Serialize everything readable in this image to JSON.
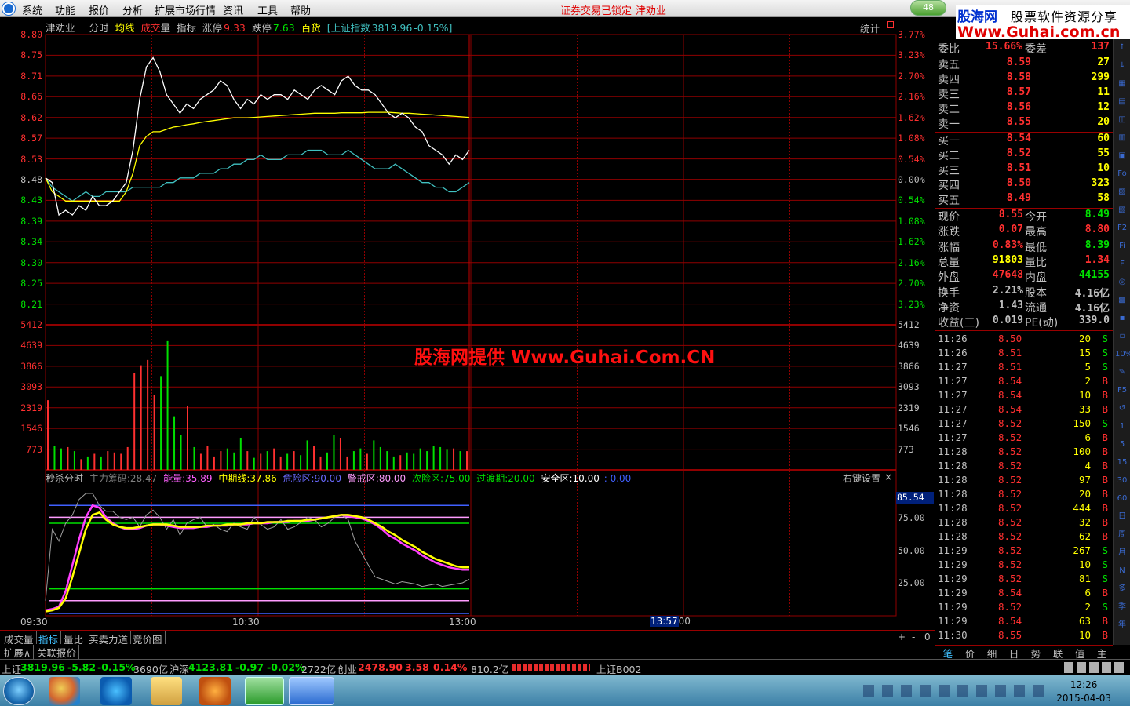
{
  "menu": {
    "items": [
      "系统",
      "功能",
      "报价",
      "分析",
      "扩展市场行情",
      "资讯",
      "工具",
      "帮助"
    ],
    "lock_status": "证券交易已锁定",
    "stock_name": "津劝业",
    "badge": "48"
  },
  "logo": {
    "line1": "股海网",
    "line1b": "股票软件资源分享",
    "line2": "Www.Guhai.com.cn"
  },
  "watermark": "股海网提供 Www.Guhai.Com.CN",
  "infobar": {
    "name": "津劝业",
    "mode": "分时",
    "avg": "均线",
    "vol1": "成交",
    "vol2": "量",
    "ind": "指标",
    "zt_label": "涨停",
    "zt": "9.33",
    "dt_label": "跌停",
    "dt": "7.63",
    "sector": "百货",
    "index": "[上证指数",
    "index_val": "3819.96",
    "index_chg": "-0.15%]",
    "stat": "统计"
  },
  "price_axis": {
    "left": [
      "8.80",
      "8.75",
      "8.71",
      "8.66",
      "8.62",
      "8.57",
      "8.53",
      "8.48",
      "8.43",
      "8.39",
      "8.34",
      "8.30",
      "8.25",
      "8.21"
    ],
    "right": [
      "3.77%",
      "3.23%",
      "2.70%",
      "2.16%",
      "1.62%",
      "1.08%",
      "0.54%",
      "0.00%",
      "0.54%",
      "1.08%",
      "1.62%",
      "2.16%",
      "2.70%",
      "3.23%"
    ],
    "ref_index": 7
  },
  "vol_axis": [
    "5412",
    "4639",
    "3866",
    "3093",
    "2319",
    "1546",
    "773"
  ],
  "ind_bar": {
    "name": "秒杀分时",
    "zl_label": "主力筹码:",
    "zl": "28.47",
    "nl_label": "能量:",
    "nl": "35.89",
    "zq_label": "中期线:",
    "zq": "37.86",
    "wx_label": "危险区:",
    "wx": "90.00",
    "jj_label": "警戒区:",
    "jj": "80.00",
    "cw_label": "次险区:",
    "cw": "75.00",
    "gd_label": "过渡期:",
    "gd": "20.00",
    "aq_label": "安全区:",
    "aq": "10.00",
    "tail": ": 0.00",
    "rclick": "右键设置",
    "close": "×"
  },
  "ind_axis": {
    "hl": "85.54",
    "ticks": [
      "75.00",
      "50.00",
      "25.00"
    ]
  },
  "time_axis": [
    "09:30",
    "10:30",
    "13:00"
  ],
  "cursor_time": "13:57",
  "cursor_tail": "00",
  "chart_controls": [
    "+",
    "-",
    "0"
  ],
  "bottom_tabs": [
    "成交量",
    "指标",
    "量比",
    "买卖力道",
    "竞价图"
  ],
  "ext_tabs": [
    "扩展∧",
    "关联报价"
  ],
  "orderbook": {
    "wb_label": "委比",
    "wb": "15.66%",
    "wc_label": "委差",
    "wc": "137",
    "asks": [
      {
        "label": "卖五",
        "price": "8.59",
        "vol": "27"
      },
      {
        "label": "卖四",
        "price": "8.58",
        "vol": "299"
      },
      {
        "label": "卖三",
        "price": "8.57",
        "vol": "11"
      },
      {
        "label": "卖二",
        "price": "8.56",
        "vol": "12"
      },
      {
        "label": "卖一",
        "price": "8.55",
        "vol": "20"
      }
    ],
    "bids": [
      {
        "label": "买一",
        "price": "8.54",
        "vol": "60"
      },
      {
        "label": "买二",
        "price": "8.52",
        "vol": "55"
      },
      {
        "label": "买三",
        "price": "8.51",
        "vol": "10"
      },
      {
        "label": "买四",
        "price": "8.50",
        "vol": "323"
      },
      {
        "label": "买五",
        "price": "8.49",
        "vol": "58"
      }
    ]
  },
  "stats": [
    {
      "l1": "现价",
      "v1": "8.55",
      "c1": "#ff3030",
      "l2": "今开",
      "v2": "8.49",
      "c2": "#00e000"
    },
    {
      "l1": "涨跌",
      "v1": "0.07",
      "c1": "#ff3030",
      "l2": "最高",
      "v2": "8.80",
      "c2": "#ff3030"
    },
    {
      "l1": "涨幅",
      "v1": "0.83%",
      "c1": "#ff3030",
      "l2": "最低",
      "v2": "8.39",
      "c2": "#00e000"
    },
    {
      "l1": "总量",
      "v1": "91803",
      "c1": "#ffff00",
      "l2": "量比",
      "v2": "1.34",
      "c2": "#ff3030"
    },
    {
      "l1": "外盘",
      "v1": "47648",
      "c1": "#ff3030",
      "l2": "内盘",
      "v2": "44155",
      "c2": "#00e000"
    },
    {
      "l1": "换手",
      "v1": "2.21%",
      "c1": "#c0c0c0",
      "l2": "股本",
      "v2": "4.16亿",
      "c2": "#c0c0c0"
    },
    {
      "l1": "净资",
      "v1": "1.43",
      "c1": "#c0c0c0",
      "l2": "流通",
      "v2": "4.16亿",
      "c2": "#c0c0c0"
    },
    {
      "l1": "收益(三)",
      "v1": "0.019",
      "c1": "#c0c0c0",
      "l2": "PE(动)",
      "v2": "339.0",
      "c2": "#c0c0c0"
    }
  ],
  "ticks": [
    {
      "t": "11:26",
      "p": "8.50",
      "v": "20",
      "s": "S"
    },
    {
      "t": "11:26",
      "p": "8.51",
      "v": "15",
      "s": "S"
    },
    {
      "t": "11:27",
      "p": "8.51",
      "v": "5",
      "s": "S"
    },
    {
      "t": "11:27",
      "p": "8.54",
      "v": "2",
      "s": "B"
    },
    {
      "t": "11:27",
      "p": "8.54",
      "v": "10",
      "s": "B"
    },
    {
      "t": "11:27",
      "p": "8.54",
      "v": "33",
      "s": "B"
    },
    {
      "t": "11:27",
      "p": "8.52",
      "v": "150",
      "s": "S"
    },
    {
      "t": "11:27",
      "p": "8.52",
      "v": "6",
      "s": "B"
    },
    {
      "t": "11:28",
      "p": "8.52",
      "v": "100",
      "s": "B"
    },
    {
      "t": "11:28",
      "p": "8.52",
      "v": "4",
      "s": "B"
    },
    {
      "t": "11:28",
      "p": "8.52",
      "v": "97",
      "s": "B"
    },
    {
      "t": "11:28",
      "p": "8.52",
      "v": "20",
      "s": "B"
    },
    {
      "t": "11:28",
      "p": "8.52",
      "v": "444",
      "s": "B"
    },
    {
      "t": "11:28",
      "p": "8.52",
      "v": "32",
      "s": "B"
    },
    {
      "t": "11:28",
      "p": "8.52",
      "v": "62",
      "s": "B"
    },
    {
      "t": "11:29",
      "p": "8.52",
      "v": "267",
      "s": "S"
    },
    {
      "t": "11:29",
      "p": "8.52",
      "v": "10",
      "s": "S"
    },
    {
      "t": "11:29",
      "p": "8.52",
      "v": "81",
      "s": "S"
    },
    {
      "t": "11:29",
      "p": "8.54",
      "v": "6",
      "s": "B"
    },
    {
      "t": "11:29",
      "p": "8.52",
      "v": "2",
      "s": "S"
    },
    {
      "t": "11:29",
      "p": "8.54",
      "v": "63",
      "s": "B"
    },
    {
      "t": "11:30",
      "p": "8.55",
      "v": "10",
      "s": "B"
    }
  ],
  "rp_tabs": [
    "笔",
    "价",
    "细",
    "日",
    "势",
    "联",
    "值",
    "主"
  ],
  "sidebar": [
    "↑",
    "↓",
    "▦",
    "▤",
    "◫",
    "▥",
    "▣",
    "Fo",
    "▨",
    "▧",
    "F2",
    "Fi",
    "F",
    "◎",
    "▩",
    "▪",
    "▫",
    "10%",
    "✎",
    "F5",
    "↺",
    "1",
    "5",
    "15",
    "30",
    "60",
    "日",
    "周",
    "月",
    "N",
    "多",
    "季",
    "年"
  ],
  "ticker": {
    "sh_label": "上证",
    "sh": "3819.96",
    "sh_chg": "-5.82",
    "sh_pct": "-0.15%",
    "sh_amt": "3690亿",
    "sz_label": "沪深",
    "sz": "4123.81",
    "sz_chg": "-0.97",
    "sz_pct": "-0.02%",
    "sz_amt": "2722亿",
    "cy_label": "创业",
    "cy": "2478.90",
    "cy_chg": "3.58",
    "cy_pct": "0.14%",
    "cy_amt": "810.2亿",
    "code": "上证B002"
  },
  "clock": {
    "time": "12:26",
    "date": "2015-04-03"
  },
  "colors": {
    "up": "#ff3030",
    "down": "#00e000",
    "grid": "#900000",
    "axis_up": "#ff3030",
    "yellow": "#ffff00",
    "cyan": "#40c0c0"
  },
  "chart_data": {
    "type": "line",
    "price": [
      8.49,
      8.48,
      8.41,
      8.42,
      8.41,
      8.43,
      8.42,
      8.45,
      8.43,
      8.43,
      8.44,
      8.46,
      8.48,
      8.55,
      8.66,
      8.73,
      8.75,
      8.72,
      8.67,
      8.65,
      8.63,
      8.65,
      8.64,
      8.66,
      8.67,
      8.68,
      8.7,
      8.69,
      8.66,
      8.64,
      8.66,
      8.65,
      8.67,
      8.66,
      8.67,
      8.67,
      8.66,
      8.68,
      8.67,
      8.66,
      8.68,
      8.69,
      8.68,
      8.67,
      8.7,
      8.71,
      8.69,
      8.68,
      8.68,
      8.67,
      8.65,
      8.63,
      8.62,
      8.63,
      8.62,
      8.6,
      8.59,
      8.56,
      8.55,
      8.54,
      8.52,
      8.54,
      8.53,
      8.55
    ],
    "avg": [
      8.49,
      8.46,
      8.45,
      8.44,
      8.44,
      8.44,
      8.44,
      8.44,
      8.44,
      8.44,
      8.44,
      8.44,
      8.46,
      8.5,
      8.56,
      8.58,
      8.59,
      8.59,
      8.595,
      8.6,
      8.602,
      8.605,
      8.607,
      8.61,
      8.612,
      8.614,
      8.616,
      8.618,
      8.62,
      8.62,
      8.62,
      8.621,
      8.622,
      8.623,
      8.624,
      8.625,
      8.626,
      8.627,
      8.628,
      8.629,
      8.63,
      8.63,
      8.63,
      8.63,
      8.631,
      8.631,
      8.631,
      8.631,
      8.632,
      8.632,
      8.632,
      8.632,
      8.631,
      8.63,
      8.63,
      8.629,
      8.628,
      8.627,
      8.626,
      8.625,
      8.624,
      8.623,
      8.622,
      8.621
    ],
    "index": [
      8.49,
      8.47,
      8.46,
      8.45,
      8.44,
      8.45,
      8.46,
      8.45,
      8.45,
      8.46,
      8.46,
      8.46,
      8.46,
      8.47,
      8.47,
      8.47,
      8.47,
      8.47,
      8.48,
      8.48,
      8.49,
      8.49,
      8.49,
      8.5,
      8.5,
      8.5,
      8.51,
      8.51,
      8.52,
      8.52,
      8.53,
      8.53,
      8.54,
      8.53,
      8.53,
      8.53,
      8.54,
      8.54,
      8.54,
      8.55,
      8.55,
      8.55,
      8.54,
      8.54,
      8.54,
      8.55,
      8.54,
      8.53,
      8.52,
      8.51,
      8.51,
      8.51,
      8.52,
      8.51,
      8.5,
      8.49,
      8.48,
      8.48,
      8.47,
      8.47,
      8.46,
      8.46,
      8.47,
      8.48
    ],
    "volume": [
      2600,
      900,
      800,
      850,
      700,
      400,
      500,
      600,
      500,
      700,
      650,
      600,
      850,
      3600,
      3900,
      4100,
      2800,
      3500,
      4800,
      2000,
      1300,
      2400,
      850,
      600,
      900,
      500,
      700,
      800,
      650,
      1200,
      700,
      450,
      600,
      700,
      800,
      500,
      600,
      700,
      550,
      1100,
      900,
      500,
      650,
      1300,
      1200,
      500,
      700,
      800,
      600,
      1100,
      850,
      700,
      500,
      550,
      650,
      600,
      800,
      700,
      900,
      850,
      750,
      800,
      700,
      700
    ],
    "ind_energy": [
      2,
      3,
      5,
      18,
      40,
      62,
      80,
      90,
      88,
      80,
      75,
      72,
      70,
      70,
      71,
      73,
      74,
      74,
      73,
      72,
      71,
      71,
      71,
      72,
      72,
      73,
      73,
      73,
      74,
      74,
      74,
      75,
      75,
      75,
      76,
      76,
      76,
      77,
      77,
      77,
      78,
      79,
      80,
      81,
      82,
      81,
      80,
      79,
      77,
      74,
      70,
      65,
      62,
      58,
      55,
      52,
      48,
      45,
      42,
      40,
      38,
      37,
      36,
      36
    ],
    "ind_mid": [
      1,
      2,
      4,
      12,
      30,
      50,
      70,
      82,
      84,
      78,
      74,
      72,
      71,
      71,
      72,
      73,
      74,
      74,
      74,
      73,
      72,
      72,
      72,
      72,
      73,
      73,
      73,
      74,
      74,
      74,
      75,
      75,
      75,
      76,
      76,
      76,
      77,
      77,
      77,
      78,
      78,
      79,
      80,
      81,
      82,
      82,
      81,
      80,
      78,
      75,
      72,
      68,
      65,
      61,
      58,
      55,
      51,
      48,
      45,
      43,
      41,
      39,
      38,
      38
    ],
    "ind_main": [
      10,
      70,
      60,
      75,
      82,
      95,
      100,
      100,
      90,
      85,
      85,
      80,
      78,
      80,
      72,
      82,
      86,
      80,
      70,
      78,
      65,
      75,
      78,
      80,
      72,
      74,
      70,
      68,
      75,
      72,
      70,
      80,
      74,
      70,
      72,
      78,
      70,
      72,
      76,
      80,
      78,
      72,
      75,
      80,
      82,
      78,
      60,
      50,
      40,
      30,
      28,
      26,
      24,
      26,
      25,
      24,
      22,
      23,
      24,
      22,
      23,
      24,
      25,
      28
    ],
    "ylim_price": [
      8.21,
      8.8
    ],
    "ylim_vol": [
      0,
      5412
    ],
    "ylim_ind": [
      0,
      100
    ],
    "ind_levels": [
      90,
      80,
      75,
      20,
      10
    ]
  }
}
